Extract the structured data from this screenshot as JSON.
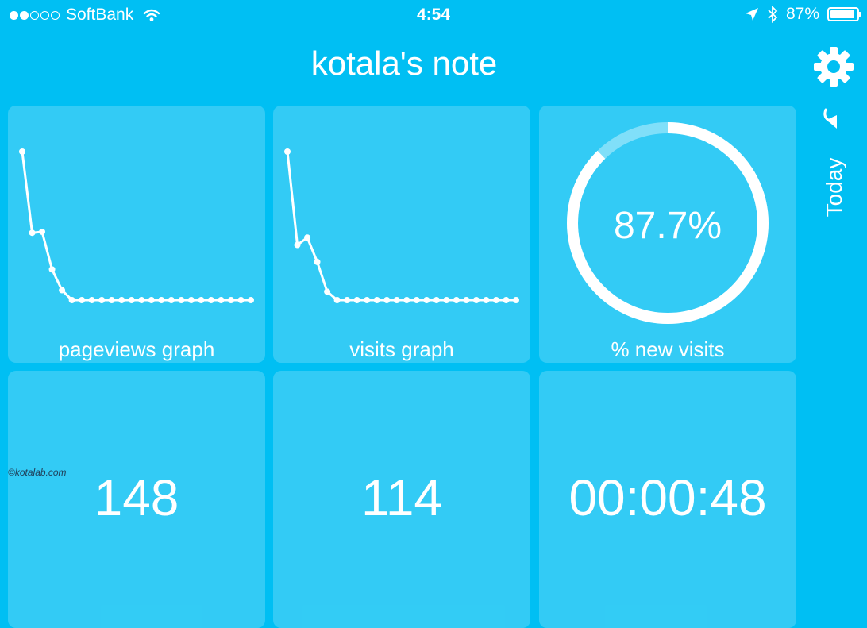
{
  "status_bar": {
    "carrier": "SoftBank",
    "signal_bars_filled": 2,
    "signal_bars_total": 5,
    "time": "4:54",
    "battery_percent": "87%",
    "icons": [
      "wifi-icon",
      "location-arrow-icon",
      "bluetooth-icon",
      "battery-icon"
    ]
  },
  "header": {
    "title": "kotala's note",
    "settings_icon": "gear-icon"
  },
  "side": {
    "today_label": "Today",
    "today_icon": "refresh-arrow-icon"
  },
  "tiles": {
    "pageviews": {
      "label": "pageviews graph"
    },
    "visits": {
      "label": "visits graph"
    },
    "new_visits": {
      "label": "% new visits",
      "value_text": "87.7%",
      "fraction": 0.877
    },
    "t4": {
      "value": "148"
    },
    "t5": {
      "value": "114"
    },
    "t6": {
      "value": "00:00:48"
    }
  },
  "chart_data": [
    {
      "type": "line",
      "title": "pageviews graph",
      "values": [
        150,
        68,
        69,
        31,
        10,
        0,
        0,
        0,
        0,
        0,
        0,
        0,
        0,
        0,
        0,
        0,
        0,
        0,
        0,
        0,
        0,
        0,
        0,
        0
      ],
      "axes_visible": false
    },
    {
      "type": "line",
      "title": "visits graph",
      "values": [
        140,
        52,
        59,
        36,
        8,
        0,
        0,
        0,
        0,
        0,
        0,
        0,
        0,
        0,
        0,
        0,
        0,
        0,
        0,
        0,
        0,
        0,
        0,
        0
      ],
      "axes_visible": false
    }
  ],
  "footer": {
    "copyright": "©kotalab.com"
  },
  "colors": {
    "background": "#00bff3",
    "tile": "#33ccf5",
    "foreground": "#ffffff",
    "ring_track": "#80dff9",
    "copyright": "#20405a"
  }
}
